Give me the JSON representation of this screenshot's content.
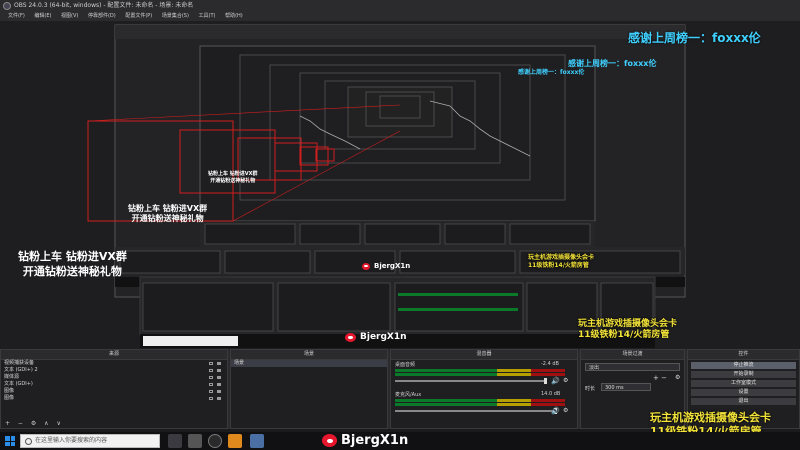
{
  "window": {
    "title": "OBS 24.0.3 (64-bit, windows) - 配置文件: 未命名 - 场景: 未命名"
  },
  "menu": {
    "items": [
      "文件(F)",
      "编辑(E)",
      "视图(V)",
      "停靠部件(D)",
      "配置文件(P)",
      "场景集合(S)",
      "工具(T)",
      "帮助(H)"
    ]
  },
  "overlay": {
    "thanks": "感谢上周榜一：foxxx伦",
    "promo_line1": "钻粉上车 钻粉进VX群",
    "promo_line2": "开通钻粉送神秘礼物",
    "weibo_handle": "BjergX1n",
    "yellow_line1": "玩主机游戏插摄像头会卡",
    "yellow_line2": "11级铁粉14/火箭房管"
  },
  "sources": {
    "header": "来源",
    "items": [
      "视频捕获设备",
      "文本 (GDI+) 2",
      "媒体源",
      "文本 (GDI+)",
      "图像",
      "图像"
    ],
    "footer_controls": "+ − ⚙ ∧ ∨"
  },
  "scenes": {
    "header": "场景",
    "items": [
      "场景"
    ]
  },
  "mixer": {
    "header": "混音器",
    "tracks": [
      {
        "name": "桌面音频",
        "db": "-2.4 dB"
      },
      {
        "name": "麦克风/Aux",
        "db": "14.0 dB"
      }
    ]
  },
  "transitions": {
    "header": "场景过渡",
    "type": "淡出",
    "duration_label": "时长",
    "duration_value": "300 ms"
  },
  "controls": {
    "header": "控件",
    "buttons": [
      "停止推流",
      "开始录制",
      "工作室模式",
      "设置",
      "退出"
    ]
  },
  "taskbar": {
    "search_placeholder": "在这里输入你要搜索的内容"
  },
  "colors": {
    "accent_blue": "#3fd0ff",
    "promo_yellow": "#f4e43a",
    "weibo_red": "#e6162d",
    "outline_red": "#d01e1e"
  }
}
